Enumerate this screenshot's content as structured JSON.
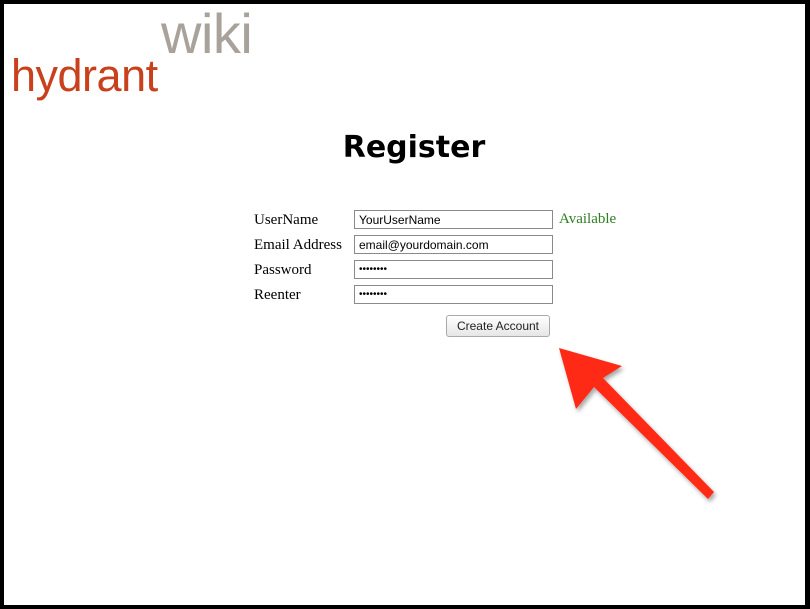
{
  "logo": {
    "part1": "hydrant",
    "part2": "wiki"
  },
  "page": {
    "title": "Register"
  },
  "form": {
    "username": {
      "label": "UserName",
      "value": "YourUserName",
      "status": "Available"
    },
    "email": {
      "label": "Email Address",
      "value": "email@yourdomain.com"
    },
    "password": {
      "label": "Password",
      "value": "••••••••"
    },
    "reenter": {
      "label": "Reenter",
      "value": "••••••••"
    },
    "submit_label": "Create Account"
  },
  "colors": {
    "logo_primary": "#c8401c",
    "logo_secondary": "#a8a29a",
    "status_ok": "#2e7d24",
    "annotation_arrow": "#ff2a14"
  },
  "annotation": {
    "icon": "arrow-icon",
    "points_to": "create-account-button"
  }
}
